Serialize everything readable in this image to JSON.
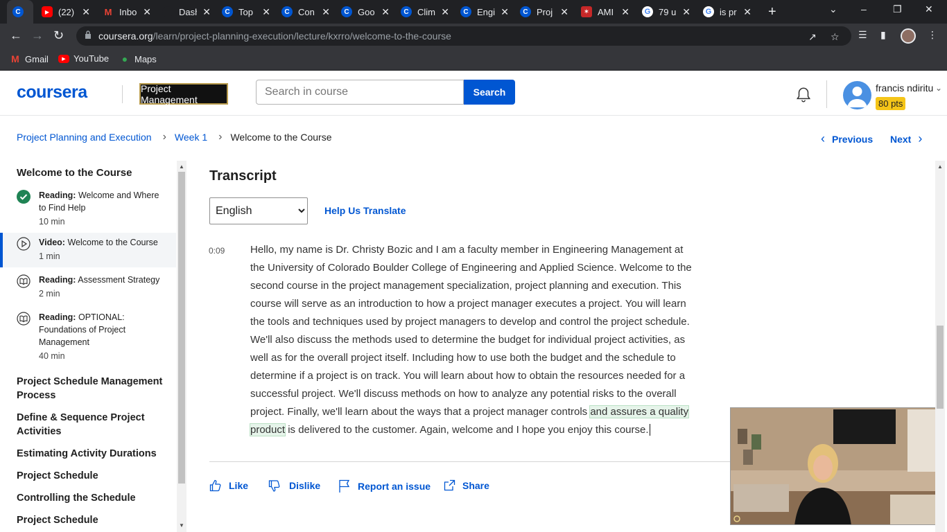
{
  "browser": {
    "tabs": [
      {
        "title": "",
        "icon": "coursera-icon",
        "color": "#0056d2",
        "active": true
      },
      {
        "title": "(22)",
        "icon": "youtube-icon",
        "color": "#ff0000"
      },
      {
        "title": "Inbo",
        "icon": "gmail-icon",
        "color": "#ea4335"
      },
      {
        "title": "Dash",
        "icon": "blank-icon",
        "color": "#202124"
      },
      {
        "title": "Top",
        "icon": "coursera-icon",
        "color": "#0056d2"
      },
      {
        "title": "Con",
        "icon": "coursera-icon",
        "color": "#0056d2"
      },
      {
        "title": "Goo",
        "icon": "coursera-icon",
        "color": "#0056d2"
      },
      {
        "title": "Clim",
        "icon": "coursera-icon",
        "color": "#0056d2"
      },
      {
        "title": "Engi",
        "icon": "coursera-icon",
        "color": "#0056d2"
      },
      {
        "title": "Proj",
        "icon": "coursera-icon",
        "color": "#0056d2"
      },
      {
        "title": "AMI",
        "icon": "ami-icon",
        "color": "#c62828"
      },
      {
        "title": "79 u",
        "icon": "google-icon",
        "color": "#ffffff"
      },
      {
        "title": "is pr",
        "icon": "google-icon",
        "color": "#ffffff"
      }
    ],
    "url_host": "coursera.org",
    "url_path": "/learn/project-planning-execution/lecture/kxrro/welcome-to-the-course",
    "bookmarks": [
      {
        "label": "Gmail",
        "icon": "gmail-icon"
      },
      {
        "label": "YouTube",
        "icon": "youtube-icon"
      },
      {
        "label": "Maps",
        "icon": "maps-icon"
      }
    ]
  },
  "header": {
    "logo": "coursera",
    "badge": "Project Management",
    "search_placeholder": "Search in course",
    "search_button": "Search",
    "user_name": "francis ndiritu",
    "points": "80 pts"
  },
  "breadcrumb": {
    "course": "Project Planning and Execution",
    "week": "Week 1",
    "current": "Welcome to the Course"
  },
  "nav": {
    "previous": "Previous",
    "next": "Next"
  },
  "sidebar": {
    "heading": "Welcome to the Course",
    "items": [
      {
        "type": "Reading:",
        "title": "Welcome and Where to Find Help",
        "duration": "10 min",
        "status": "completed"
      },
      {
        "type": "Video:",
        "title": "Welcome to the Course",
        "duration": "1 min",
        "status": "current"
      },
      {
        "type": "Reading:",
        "title": "Assessment Strategy",
        "duration": "2 min",
        "status": "todo"
      },
      {
        "type": "Reading:",
        "title": "OPTIONAL: Foundations of Project Management",
        "duration": "40 min",
        "status": "todo"
      }
    ],
    "sections": [
      "Project Schedule Management Process",
      "Define & Sequence Project Activities",
      "Estimating Activity Durations",
      "Project Schedule",
      "Controlling the Schedule",
      "Project Schedule"
    ]
  },
  "transcript": {
    "title": "Transcript",
    "language": "English",
    "help_translate": "Help Us Translate",
    "timestamp": "0:09",
    "text_before": "Hello, my name is Dr. Christy Bozic and I am a faculty member in Engineering Management at the University of Colorado Boulder College of Engineering and Applied Science. Welcome to the second course in the project management specialization, project planning and execution. This course will serve as an introduction to how a project manager executes a project. You will learn the tools and techniques used by project managers to develop and control the project schedule. We'll also discuss the methods used to determine the budget for individual project activities, as well as for the overall project itself. Including how to use both the budget and the schedule to determine if a project is on track. You will learn about how to obtain the resources needed for a successful project. We'll discuss methods on how to analyze any potential risks to the overall project. Finally, we'll learn about the ways that a project manager controls ",
    "text_highlight": "and assures a quality product",
    "text_after": " is delivered to the customer. Again, welcome and I hope you enjoy this course."
  },
  "actions": {
    "like": "Like",
    "dislike": "Dislike",
    "report": "Report an issue",
    "share": "Share"
  },
  "colors": {
    "brand": "#0056d2",
    "points_badge": "#f5c518",
    "completed": "#1f8354"
  }
}
